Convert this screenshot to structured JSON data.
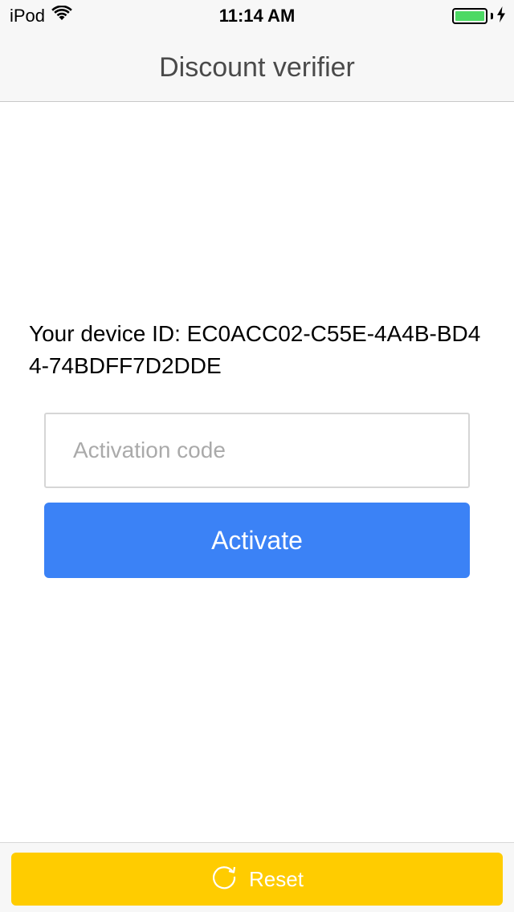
{
  "status_bar": {
    "carrier": "iPod",
    "time": "11:14 AM",
    "wifi_icon": "wifi-icon",
    "battery_icon": "battery-icon",
    "charging_icon": "charging-bolt-icon",
    "battery_level": 1.0,
    "battery_color": "#4cd964"
  },
  "nav": {
    "title": "Discount verifier"
  },
  "main": {
    "device_id_text": "Your device ID: EC0ACC02-C55E-4A4B-BD44-74BDFF7D2DDE",
    "activation_input": {
      "placeholder": "Activation code",
      "value": ""
    },
    "activate_label": "Activate",
    "activate_color": "#3b82f6"
  },
  "bottom": {
    "reset_label": "Reset",
    "reset_icon": "refresh-icon",
    "reset_color": "#ffcc00"
  }
}
